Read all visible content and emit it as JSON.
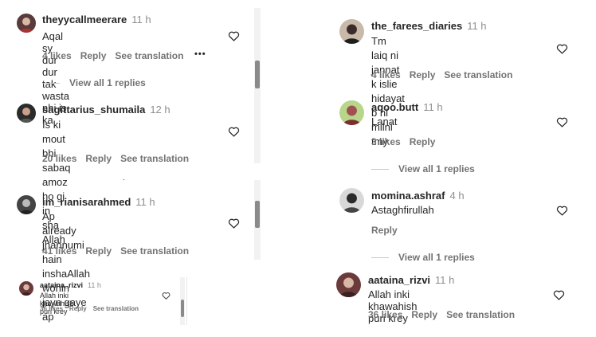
{
  "comments": {
    "c1": {
      "username": "theyycallmeerare",
      "time": "11 h",
      "text": "Aqal sy dur dur tak wasta nhi is ka",
      "likes": "4 likes",
      "reply": "Reply",
      "translation": "See translation",
      "more": "•••",
      "view_replies": "View all 1 replies"
    },
    "c2": {
      "username": "sagittarius_shumaila",
      "time": "12 h",
      "text": "Is ki mout bhi sabaq amoz ho gi in\nsha Allah",
      "likes": "20 likes",
      "reply": "Reply",
      "translation": "See translation"
    },
    "c3": {
      "username": "im_rianisarahmed",
      "time": "11 h",
      "text": "Ap already jhannumi hain\ninshaAllah wohin jayn gaye ap",
      "likes": "41 likes",
      "reply": "Reply",
      "translation": "See translation"
    },
    "c4": {
      "username": "aataina_rizvi",
      "time": "11 h",
      "text": "Allah inki khawahish puri krey",
      "likes": "36 likes",
      "reply": "Reply",
      "translation": "See translation"
    },
    "c5": {
      "username": "the_farees_diaries",
      "time": "11 h",
      "text": "Tm laiq ni jannat k islie hidayat b ni\nmilni tmy",
      "likes": "4 likes",
      "reply": "Reply",
      "translation": "See translation"
    },
    "c6": {
      "username": "aqoo.butt",
      "time": "11 h",
      "text": "Lanat",
      "likes": "3 likes",
      "reply": "Reply",
      "view_replies": "View all 1 replies"
    },
    "c7": {
      "username": "momina.ashraf",
      "time": "4 h",
      "text": "Astaghfirullah",
      "reply": "Reply",
      "view_replies": "View all 1 replies"
    },
    "c8": {
      "username": "aataina_rizvi",
      "time": "11 h",
      "text": "Allah inki khawahish puri krey",
      "likes": "36 likes",
      "reply": "Reply",
      "translation": "See translation"
    }
  },
  "icons": {
    "like": "heart-outline-icon",
    "avatar": "user-avatar"
  },
  "colors": {
    "text": "#262626",
    "muted": "#737373",
    "time": "#8e8e8e"
  }
}
